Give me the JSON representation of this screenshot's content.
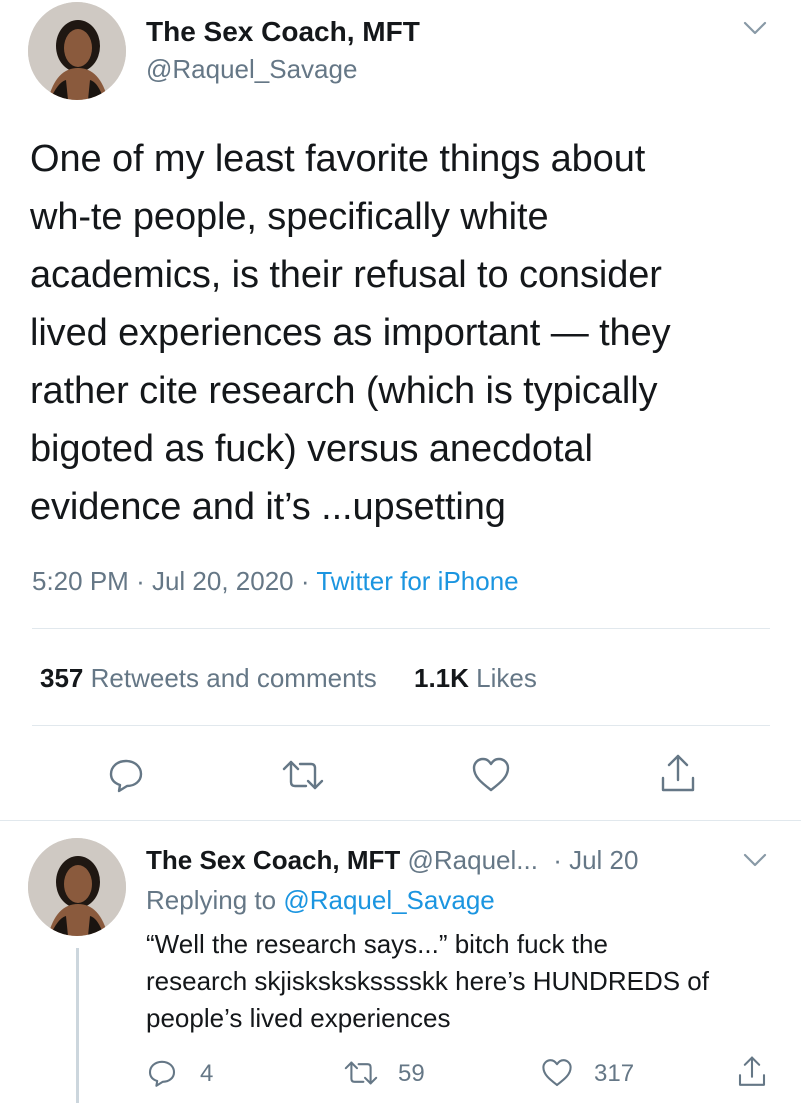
{
  "main_tweet": {
    "author_name": "The Sex Coach, MFT",
    "author_handle": "@Raquel_Savage",
    "text_lines": [
      "One of my least favorite things about",
      "wh-te people, specifically white",
      "academics, is their refusal to consider",
      "lived experiences as important — they",
      "rather cite research (which is typically",
      "bigoted as fuck) versus anecdotal",
      "evidence and it’s ...upsetting"
    ],
    "time": "5:20 PM",
    "sep1": "·",
    "date": "Jul 20, 2020",
    "sep2": "·",
    "source": "Twitter for iPhone",
    "retweets_count": "357",
    "retweets_label": "Retweets and comments",
    "likes_count": "1.1K",
    "likes_label": "Likes"
  },
  "reply_tweet": {
    "author_name": "The Sex Coach, MFT",
    "author_handle": "@Raquel...",
    "date": "· Jul 20",
    "replying_prefix": "Replying to",
    "replying_handle": "@Raquel_Savage",
    "text_lines": [
      "“Well the research says...” bitch fuck the",
      "research skjisksksksssskk here’s HUNDREDS of",
      "people’s lived experiences"
    ],
    "reply_count": "4",
    "retweet_count": "59",
    "like_count": "317"
  },
  "icons": {
    "reply": "reply-icon",
    "retweet": "retweet-icon",
    "like": "heart-icon",
    "share": "share-icon",
    "menu": "chevron-down-icon"
  },
  "colors": {
    "text": "#14171a",
    "secondary": "#657786",
    "link": "#1b95e0",
    "divider": "#e1e8ed"
  }
}
